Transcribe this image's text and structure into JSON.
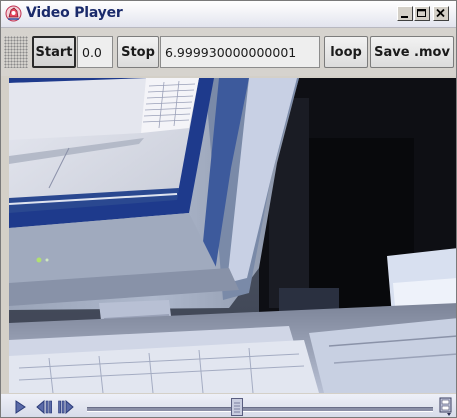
{
  "window": {
    "title": "Video Player",
    "title_icon": "duke-app-icon",
    "controls": [
      "minimize-icon",
      "maximize-icon",
      "close-icon"
    ]
  },
  "toolbar": {
    "start_label": "Start",
    "start_value": "0.0",
    "stop_label": "Stop",
    "stop_value": "6.999930000000001",
    "loop_label": "loop",
    "save_label": "Save .mov"
  },
  "player": {
    "controls": [
      "play-icon",
      "step-back-icon",
      "step-forward-icon",
      "filmstrip-menu-icon"
    ],
    "position_fraction": 0.43
  },
  "colors": {
    "title_text": "#1a2a6a",
    "control_bar": "#d6dae8"
  }
}
